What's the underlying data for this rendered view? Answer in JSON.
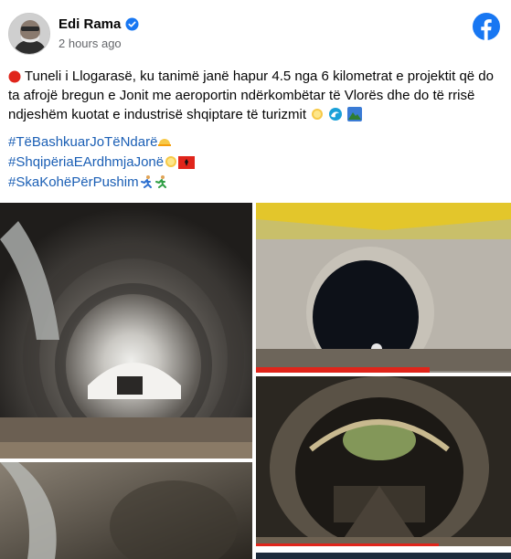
{
  "post": {
    "author": "Edi Rama",
    "timestamp": "2 hours ago",
    "text": "Tuneli i Llogarasë, ku tanimë janë hapur 4.5 nga 6 kilometrat e projektit që do ta afrojë bregun e Jonit me aeroportin ndërkombëtar të Vlorës dhe do të rrisë ndjeshëm kuotat e industrisë shqiptare të turizmit",
    "hashtags": [
      "#TëBashkuarJoTëNdarë",
      "#ShqipëriaEArdhmjaJonë",
      "#SkaKohëPërPushim"
    ]
  },
  "icons": {
    "verified": "verified-badge-icon",
    "facebook": "facebook-logo-icon",
    "bullet": "red-circle-icon"
  },
  "colors": {
    "brand_blue": "#1877f2",
    "hashtag": "#1b5fb5",
    "meta_gray": "#65676b",
    "red_accent": "#e0251b"
  },
  "photos": [
    "tunnel-interior-photo-1",
    "tunnel-portal-photo",
    "tunnel-construction-photo",
    "tunnel-interior-photo-2",
    "tunnel-photo-bottom-right"
  ]
}
